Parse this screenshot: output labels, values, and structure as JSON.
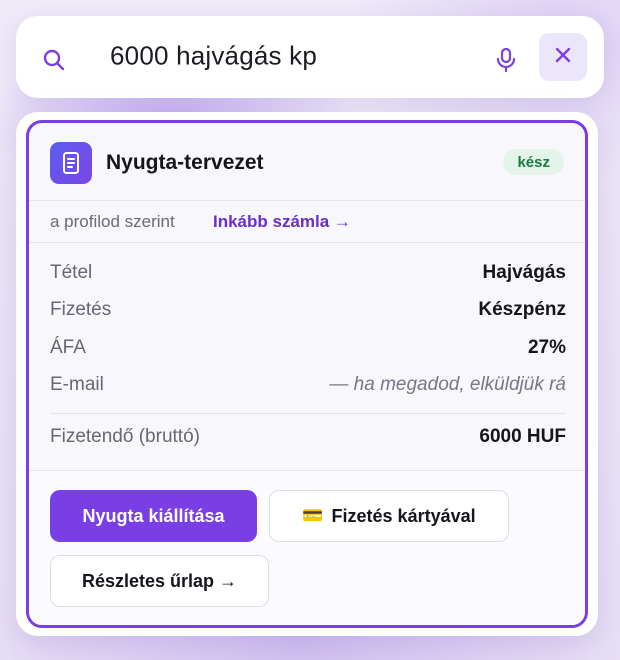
{
  "search": {
    "query": "6000 hajvágás kp",
    "icons": {
      "search": "search-icon",
      "mic": "microphone-icon",
      "clear": "close-icon"
    }
  },
  "card": {
    "icon": "receipt-icon",
    "title": "Nyugta-tervezet",
    "status": "kész",
    "profile_text": "a profilod szerint",
    "alt_link": "Inkább számla →",
    "rows": [
      {
        "label": "Tétel",
        "value": "Hajvágás"
      },
      {
        "label": "Fizetés",
        "value": "Készpénz"
      },
      {
        "label": "ÁFA",
        "value": "27%"
      },
      {
        "label": "E-mail",
        "value": "— ha megadod, elküldjük rá"
      }
    ],
    "total": {
      "label": "Fizetendő (bruttó)",
      "value": "6000 HUF"
    },
    "actions": {
      "issue": "Nyugta kiállítása",
      "card_pay_icon": "💳",
      "card_pay": "Fizetés kártyával",
      "details": "Részletes űrlap →"
    }
  },
  "colors": {
    "accent": "#7a3fe4",
    "link": "#6a2fc8",
    "status_bg": "#e5f4ea",
    "status_text": "#177c3c"
  }
}
